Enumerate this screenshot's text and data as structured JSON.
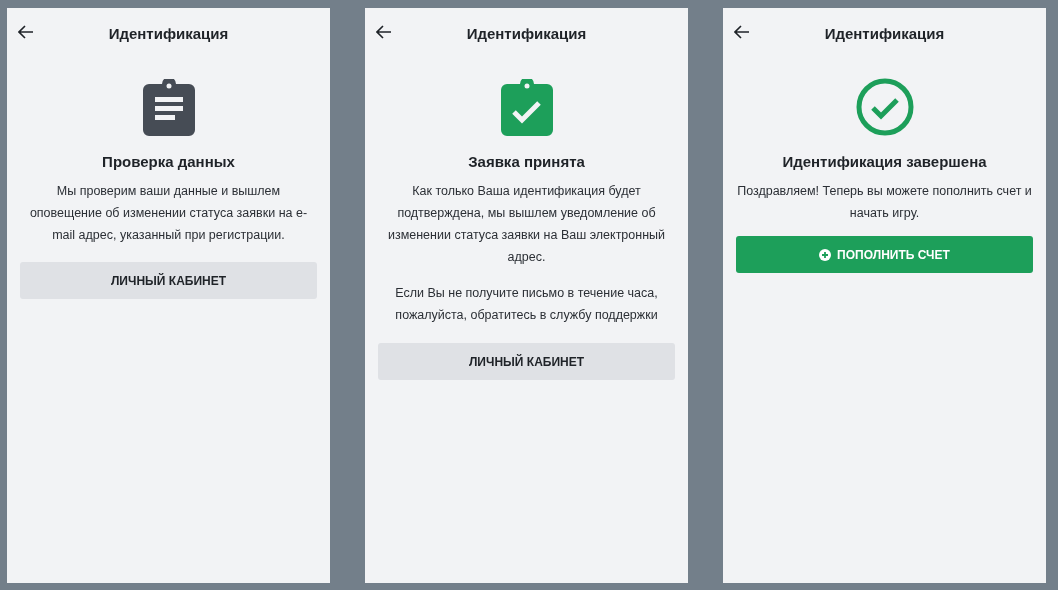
{
  "screens": [
    {
      "title": "Идентификация",
      "icon": {
        "kind": "clipboard-lines"
      },
      "heading": "Проверка данных",
      "paragraphs": [
        "Мы проверим ваши данные и вышлем оповещение об изменении статуса заявки на e-mail адрес, указанный при регистрации."
      ],
      "button": {
        "label": "ЛИЧНЫЙ КАБИНЕТ",
        "kind": "secondary"
      }
    },
    {
      "title": "Идентификация",
      "icon": {
        "kind": "clipboard-check"
      },
      "heading": "Заявка принята",
      "paragraphs": [
        "Как только Ваша идентификация будет подтверждена, мы вышлем уведомление об изменении статуса заявки на Ваш электронный адрес.",
        "Если Вы не получите письмо в течение часа, пожалуйста, обратитесь в службу поддержки"
      ],
      "button": {
        "label": "ЛИЧНЫЙ КАБИНЕТ",
        "kind": "secondary"
      }
    },
    {
      "title": "Идентификация",
      "icon": {
        "kind": "check-circle"
      },
      "heading": "Идентификация завершена",
      "paragraphs": [
        "Поздравляем! Теперь вы можете пополнить счет и начать игру."
      ],
      "button": {
        "label": "ПОПОЛНИТЬ СЧЕТ",
        "kind": "primary"
      }
    }
  ]
}
